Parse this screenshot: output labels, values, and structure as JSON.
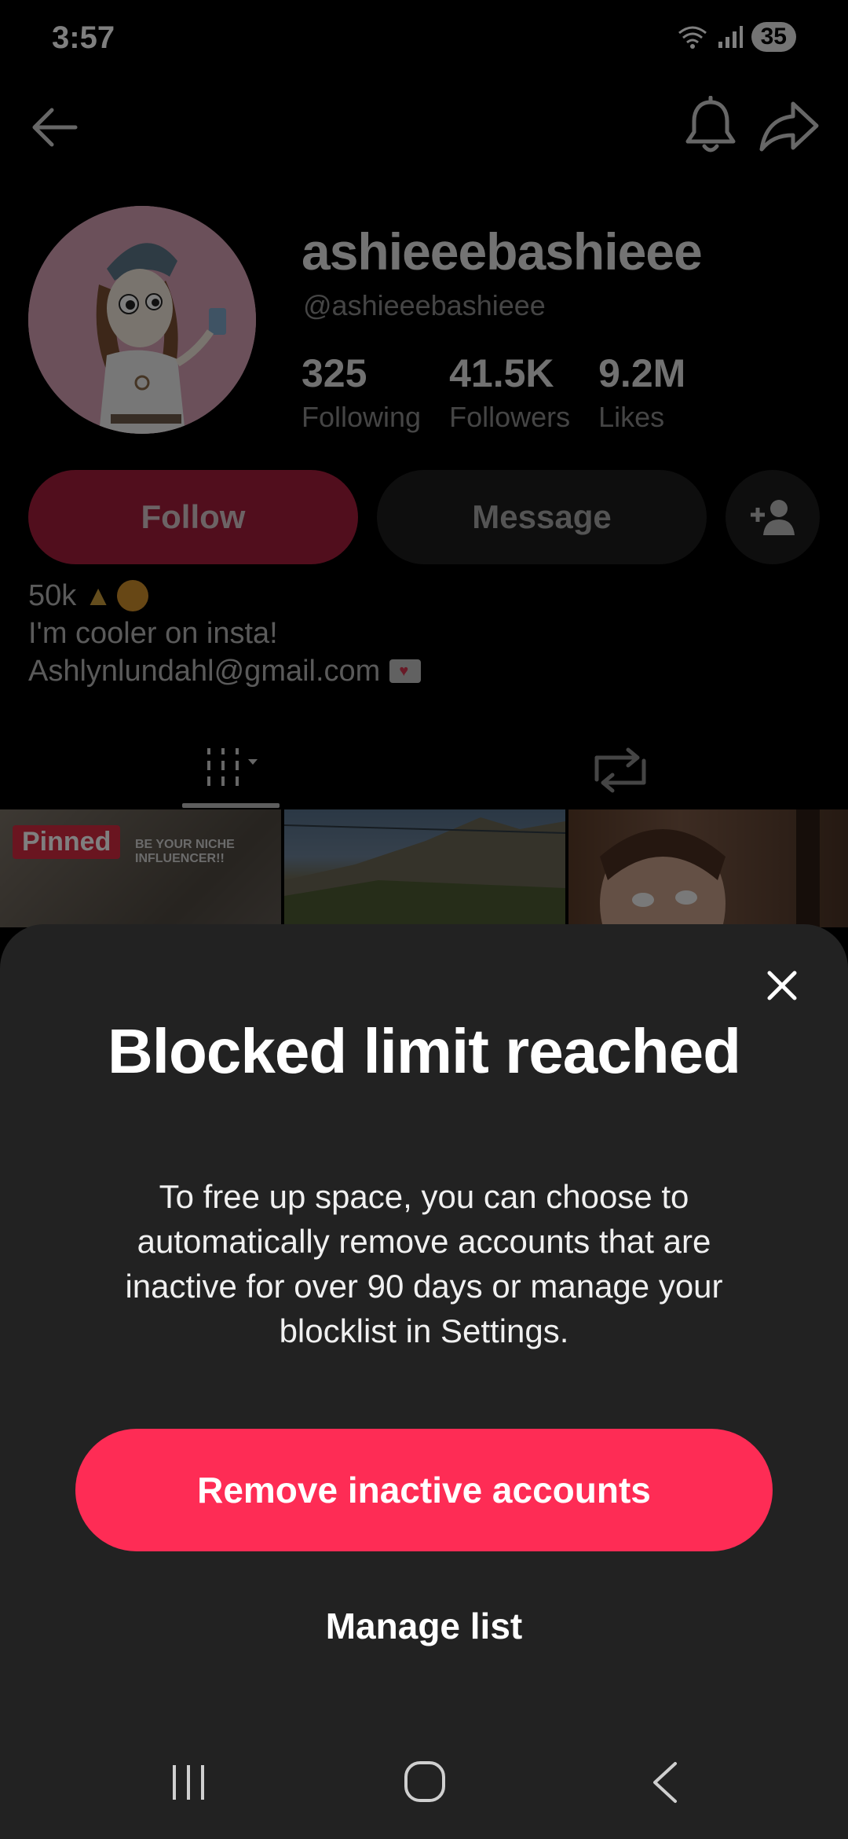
{
  "status_bar": {
    "time": "3:57",
    "battery": "35"
  },
  "nav": {
    "back_icon": "arrow-left-icon",
    "bell_icon": "bell-icon",
    "share_icon": "share-arrow-icon"
  },
  "profile": {
    "name": "ashieeebashieee",
    "handle": "@ashieeebashieee",
    "stats": [
      {
        "value": "325",
        "label": "Following"
      },
      {
        "value": "41.5K",
        "label": "Followers"
      },
      {
        "value": "9.2M",
        "label": "Likes"
      }
    ],
    "follow_label": "Follow",
    "message_label": "Message",
    "add_friend_icon": "add-friend-icon",
    "bio": {
      "line1": "50k",
      "line2": "I'm cooler on insta!",
      "line3": "Ashlynlundahl@gmail.com"
    }
  },
  "tabs": {
    "videos_icon": "videos-grid-icon",
    "reposts_icon": "repost-icon"
  },
  "grid": {
    "pinned_label": "Pinned",
    "thumb1_caption_line1": "BE YOUR NICHE",
    "thumb1_caption_line2": "INFLUENCER!!"
  },
  "sheet": {
    "title": "Blocked limit reached",
    "body": "To free up space, you can choose to automatically remove accounts that are inactive for over 90 days or manage your blocklist in Settings.",
    "primary_button": "Remove inactive accounts",
    "secondary_button": "Manage list",
    "close_icon": "close-icon"
  },
  "colors": {
    "primary": "#fe2c55",
    "sheet_bg": "#222222",
    "follow_dimmed": "#a21d3a"
  }
}
